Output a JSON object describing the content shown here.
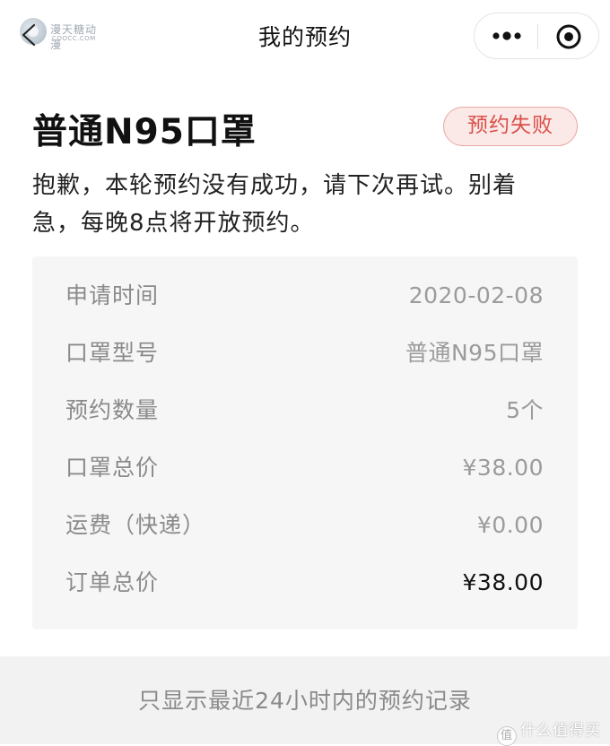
{
  "header": {
    "title": "我的预约",
    "watermark_text": "漫天糖动漫",
    "watermark_sub": "COOCC.COM",
    "back_icon": "back-icon",
    "more_icon": "more-icon",
    "close_icon": "target-icon"
  },
  "product": {
    "name": "普通N95口罩",
    "status": "预约失败",
    "status_color": "#d94f48",
    "status_bg": "#fbe9e8"
  },
  "notice": {
    "line1": "抱歉，本轮预约没有成功，请下次再试。别着",
    "line2": "急，每晚8点将开放预约。"
  },
  "details": [
    {
      "label": "申请时间",
      "value": "2020-02-08"
    },
    {
      "label": "口罩型号",
      "value": "普通N95口罩"
    },
    {
      "label": "预约数量",
      "value": "5个"
    },
    {
      "label": "口罩总价",
      "value": "¥38.00"
    },
    {
      "label": "运费（快递）",
      "value": "¥0.00"
    },
    {
      "label": "订单总价",
      "value": "¥38.00"
    }
  ],
  "footer": {
    "note": "只显示最近24小时内的预约记录",
    "corner_logo": "什么值得买",
    "corner_logo_badge": "值"
  }
}
